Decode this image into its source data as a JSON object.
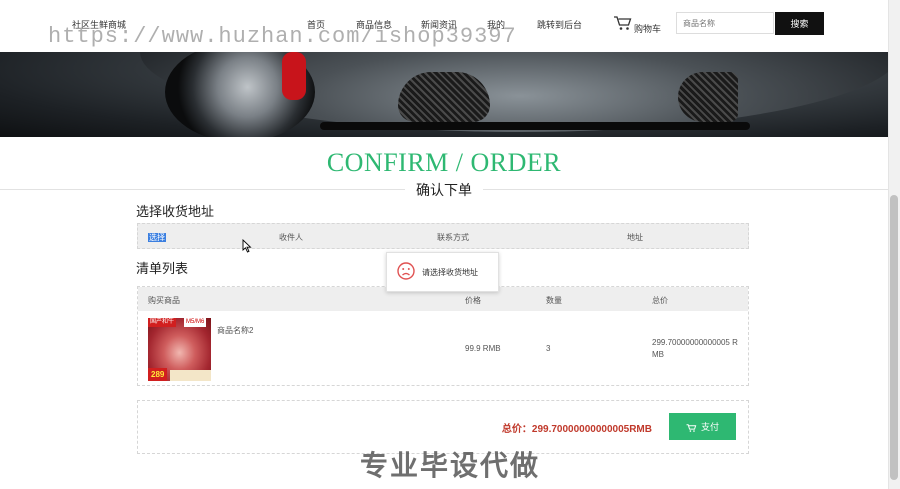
{
  "header": {
    "brand": "社区生鲜商城",
    "nav": [
      "首页",
      "商品信息",
      "新闻资讯",
      "我的",
      "跳转到后台"
    ],
    "cart_label": "购物车",
    "search_placeholder": "商品名称",
    "search_button": "搜索"
  },
  "watermark": {
    "url": "https://www.huzhan.com/ishop39397",
    "bottom_text": "专业毕设代做"
  },
  "page": {
    "title_en": "CONFIRM / ORDER",
    "title_cn": "确认下单"
  },
  "address_section": {
    "title": "选择收货地址",
    "columns": [
      "选择",
      "收件人",
      "联系方式",
      "地址"
    ]
  },
  "toast": {
    "message": "请选择收货地址",
    "icon": "sad-face-icon"
  },
  "order_section": {
    "title": "清单列表",
    "columns": [
      "购买商品",
      "价格",
      "数量",
      "总价"
    ],
    "items": [
      {
        "name": "商品名称2",
        "price": "99.9 RMB",
        "quantity": "3",
        "total": "299.70000000000005 RMB",
        "image": {
          "tag": "国产和牛",
          "grade": "M5/M6",
          "price": "289"
        }
      }
    ]
  },
  "payment": {
    "total_label": "总价：299.70000000000005RMB",
    "pay_button": "支付"
  },
  "colors": {
    "accent": "#2eb872",
    "total_red": "#c0392b",
    "selection_blue": "#3b7fe0"
  }
}
